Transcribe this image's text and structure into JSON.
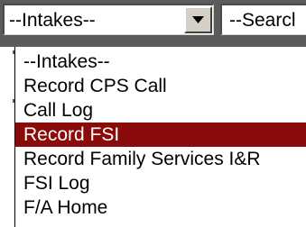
{
  "intake_select": {
    "value": "--Intakes--"
  },
  "search_select": {
    "value": "--Searcl"
  },
  "dropdown": {
    "items": [
      {
        "label": "--Intakes--",
        "selected": false
      },
      {
        "label": "Record CPS Call",
        "selected": false
      },
      {
        "label": "Call Log",
        "selected": false
      },
      {
        "label": "Record FSI",
        "selected": true
      },
      {
        "label": "Record Family Services I&R",
        "selected": false
      },
      {
        "label": "FSI Log",
        "selected": false
      },
      {
        "label": "F/A Home",
        "selected": false
      }
    ]
  },
  "colors": {
    "selection_bg": "#8b0a0a",
    "toolbar_bg": "#5b5b5b"
  },
  "icons": {
    "dropdown_arrow": "chevron-down-icon"
  }
}
